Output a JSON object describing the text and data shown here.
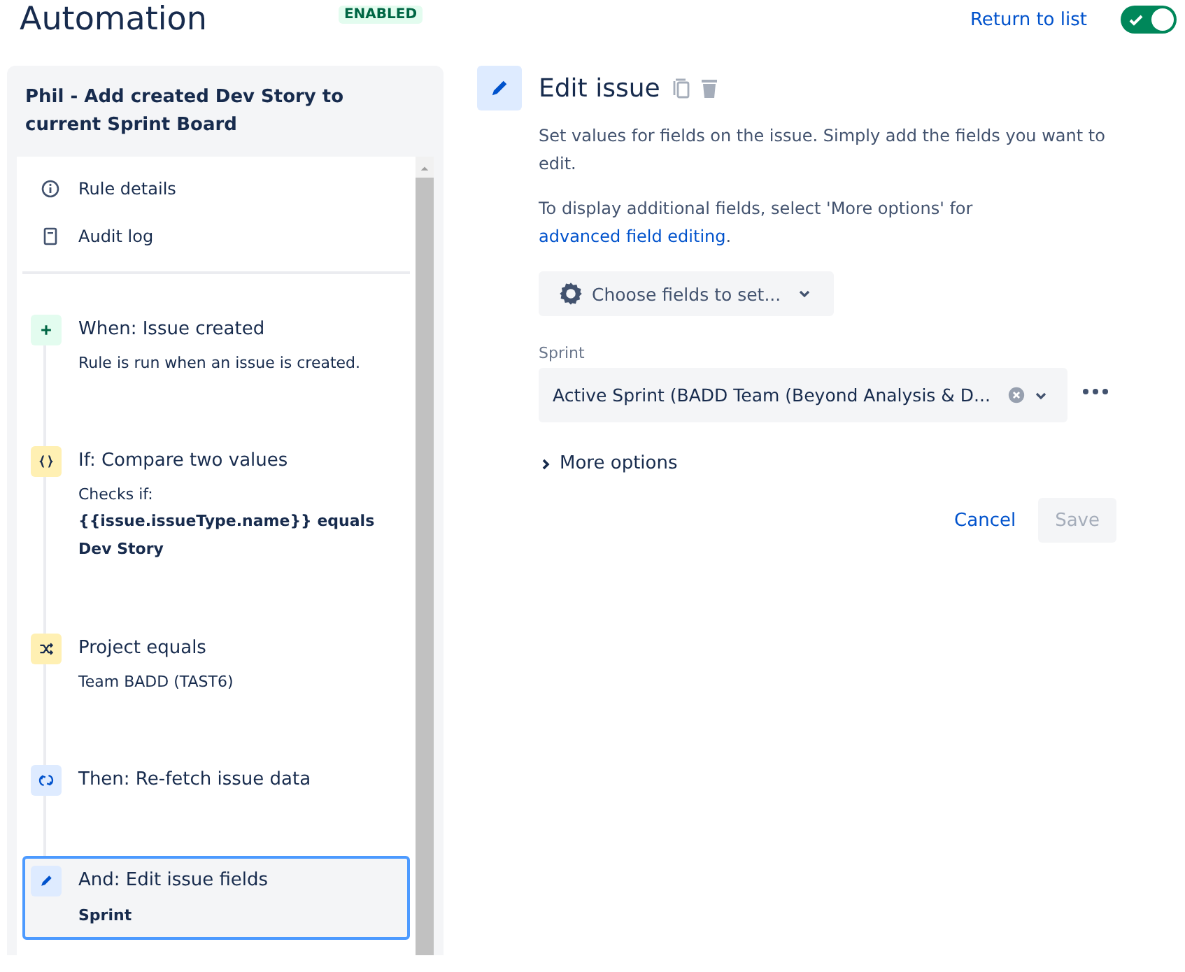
{
  "header": {
    "title": "Automation",
    "status_badge": "ENABLED",
    "return_link": "Return to list",
    "toggle": {
      "on": true
    }
  },
  "rule": {
    "name": "Phil - Add created Dev Story to current Sprint Board",
    "menu": [
      {
        "kind": "info",
        "label": "Rule details"
      },
      {
        "kind": "log",
        "label": "Audit log"
      }
    ],
    "steps": [
      {
        "kind": "trigger",
        "title": "When: Issue created",
        "description": "Rule is run when an issue is created.",
        "selected": false
      },
      {
        "kind": "condition",
        "title": "If: Compare two values",
        "description": "Checks if:",
        "detail": "{{issue.issueType.name}} equals Dev Story",
        "selected": false
      },
      {
        "kind": "branch",
        "title": "Project equals",
        "description": "Team BADD (TAST6)",
        "selected": false
      },
      {
        "kind": "refetch",
        "title": "Then: Re-fetch issue data",
        "selected": false
      },
      {
        "kind": "edit",
        "title": "And: Edit issue fields",
        "detail": "Sprint",
        "selected": true
      }
    ]
  },
  "editor": {
    "title": "Edit issue",
    "intro": "Set values for fields on the issue. Simply add the fields you want to edit.",
    "hint": "To display additional fields, select 'More options' for ",
    "hint_link": "advanced field editing",
    "hint_end": ".",
    "choose_button": "Choose fields to set...",
    "fields": [
      {
        "label": "Sprint",
        "value": "Active Sprint (BADD Team (Beyond Analysis & D..."
      }
    ],
    "more_options": {
      "label": "More options",
      "expanded": false
    },
    "cancel": "Cancel",
    "save": {
      "label": "Save",
      "disabled": true
    }
  }
}
